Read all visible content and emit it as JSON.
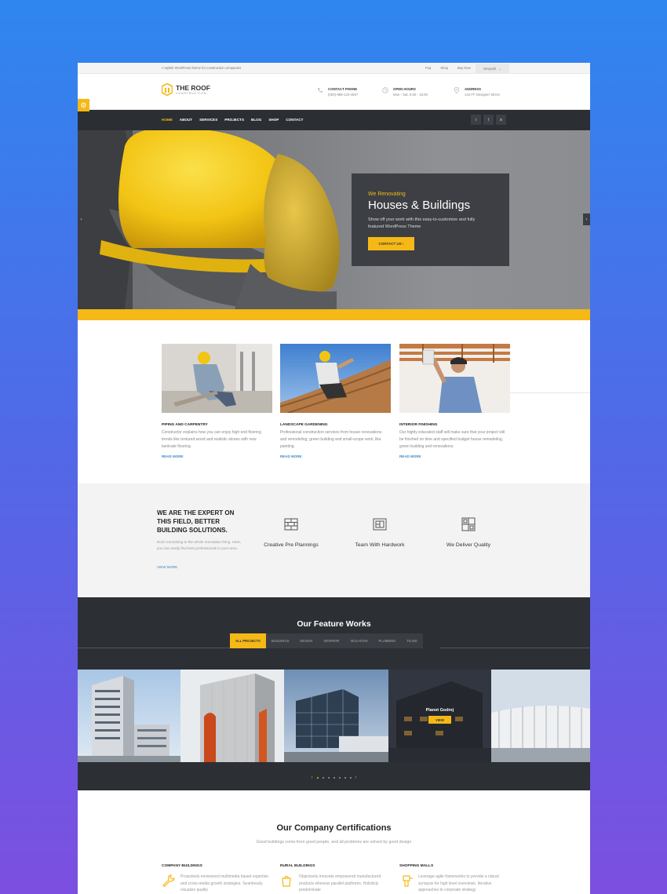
{
  "colors": {
    "accent": "#f5b817",
    "dark": "#2c2f34",
    "link": "#3a87c8"
  },
  "topbar": {
    "tagline": "A stylish WordPress theme for construction companies",
    "links": [
      "Faq",
      "Shop",
      "Buy Now"
    ],
    "location": "Newyork",
    "location_icon": "chevron-down-icon"
  },
  "logo": {
    "name": "THE ROOF",
    "sub": "CONSTRUCTION"
  },
  "header_info": [
    {
      "icon": "phone-icon",
      "label": "CONTACT PHONE",
      "value": "(000)-888-123-4567"
    },
    {
      "icon": "clock-icon",
      "label": "OPEN HOURS",
      "value": "Mon - Sat, 8.00 - 18.00"
    },
    {
      "icon": "map-pin-icon",
      "label": "ADDRESS",
      "value": "144 FF Designer Street"
    }
  ],
  "nav": {
    "items": [
      "HOME",
      "ABOUT",
      "SERVICES",
      "PROJECTS",
      "BLOG",
      "SHOP",
      "CONTACT"
    ],
    "social": [
      "t",
      "f",
      "in"
    ]
  },
  "hero": {
    "subtitle": "We Renovating",
    "title": "Houses & Buildings",
    "desc": "Show off your work with this easy-to-customize and fully featured WordPress Theme",
    "button": "CONTACT US ›",
    "prev": "‹",
    "next": "›"
  },
  "services": [
    {
      "title": "PIPING AND CARPENTRY",
      "text": "Constructor explains how you can enjoy high end flooring trends like textured wood and realistic stones with new laminate flooring.",
      "more": "READ MORE"
    },
    {
      "title": "LANDSCAPE GARDENING",
      "text": "Professional construction services from house renovations and remodeling, green building and small-scope work, like painting.",
      "more": "READ MORE"
    },
    {
      "title": "INTERIOR FINISHING",
      "text": "Our highly educated staff will make sure that your project will be finished on time and specified budget house remodeling, green building and renovations.",
      "more": "READ MORE"
    }
  ],
  "expert": {
    "heading": "WE ARE THE EXPERT ON THIS FIELD, BETTER BUILDING SOLUTIONS.",
    "text": "Roof committing to the whole renovation thing. Here, you can easily find best professionals in your area.",
    "more": "VIEW MORE",
    "features": [
      {
        "icon": "bricks-icon",
        "label": "Creative Pre Plannings"
      },
      {
        "icon": "blueprint-icon",
        "label": "Team With Hardwork"
      },
      {
        "icon": "window-icon",
        "label": "We Deliver Quality"
      }
    ]
  },
  "works": {
    "title": "Our Feature Works",
    "filters": [
      "ALL PROJECTS",
      "BUILDINGS",
      "DESIGN",
      "INTERIOR",
      "ISOLATION",
      "PLUMBING",
      "TILING"
    ],
    "hover_name": "Planet Godrej",
    "hover_button": "VIEW",
    "prev": "‹",
    "next": "›"
  },
  "cert": {
    "title": "Our Company Certifications",
    "subtitle": "Good buildings come from good people, and all problems are solved by good design",
    "items": [
      {
        "icon": "wrench-icon",
        "title": "COMPANY BUILDINGS",
        "text": "Proactively envisioned multimedia based expertise and cross-media growth strategies. Seamlessly visualize quality"
      },
      {
        "icon": "paint-bucket-icon",
        "title": "RURAL BUILDINGS",
        "text": "Objectively innovate empowered manufactured products whereas parallel platforms. Holisticly predominate"
      },
      {
        "icon": "drill-icon",
        "title": "SHOPPING MALLS",
        "text": "Leverage agile frameworks to provide a robust synopsis for high level overviews. Iterative approaches to corporate strategy"
      }
    ]
  }
}
